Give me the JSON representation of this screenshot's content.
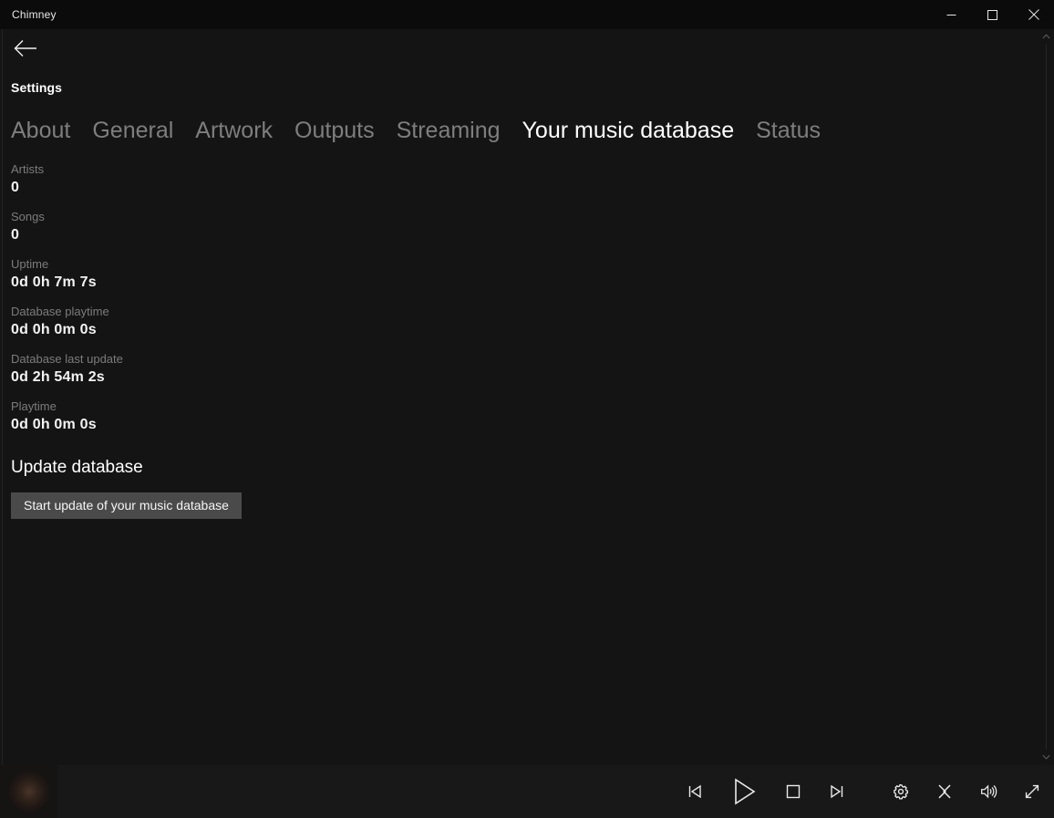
{
  "window": {
    "title": "Chimney",
    "controls": {
      "minimize": "minimize-icon",
      "maximize": "maximize-icon",
      "close": "close-icon"
    }
  },
  "nav": {
    "back_icon": "arrow-left-icon",
    "page_title": "Settings"
  },
  "tabs": [
    {
      "label": "About",
      "active": false
    },
    {
      "label": "General",
      "active": false
    },
    {
      "label": "Artwork",
      "active": false
    },
    {
      "label": "Outputs",
      "active": false
    },
    {
      "label": "Streaming",
      "active": false
    },
    {
      "label": "Your music database",
      "active": true
    },
    {
      "label": "Status",
      "active": false
    }
  ],
  "stats": [
    {
      "label": "Artists",
      "value": "0"
    },
    {
      "label": "Songs",
      "value": "0"
    },
    {
      "label": "Uptime",
      "value": "0d 0h 7m 7s"
    },
    {
      "label": "Database playtime",
      "value": "0d 0h 0m 0s"
    },
    {
      "label": "Database last update",
      "value": "0d 2h 54m 2s"
    },
    {
      "label": "Playtime",
      "value": "0d 0h 0m 0s"
    }
  ],
  "update_section": {
    "title": "Update database",
    "button_label": "Start update of your music database"
  },
  "scrollbar": {
    "up_icon": "chevron-up-icon",
    "down_icon": "chevron-down-icon"
  },
  "player": {
    "album_art_icon": "album-art-thumbnail",
    "buttons": [
      {
        "name": "previous-button",
        "icon": "skip-previous-icon"
      },
      {
        "name": "play-button",
        "icon": "play-icon"
      },
      {
        "name": "stop-button",
        "icon": "stop-icon"
      },
      {
        "name": "next-button",
        "icon": "skip-next-icon"
      },
      {
        "name": "settings-button",
        "icon": "gear-icon"
      },
      {
        "name": "crossfade-button",
        "icon": "crossfade-icon"
      },
      {
        "name": "volume-button",
        "icon": "volume-icon"
      },
      {
        "name": "fullscreen-button",
        "icon": "expand-icon"
      }
    ]
  },
  "colors": {
    "background": "#141414",
    "titlebar": "#0b0b0b",
    "player_bar": "#181818",
    "accent_text": "#ffffff",
    "muted_text": "#7c7c7c",
    "button_bg": "#4a4a4a"
  }
}
